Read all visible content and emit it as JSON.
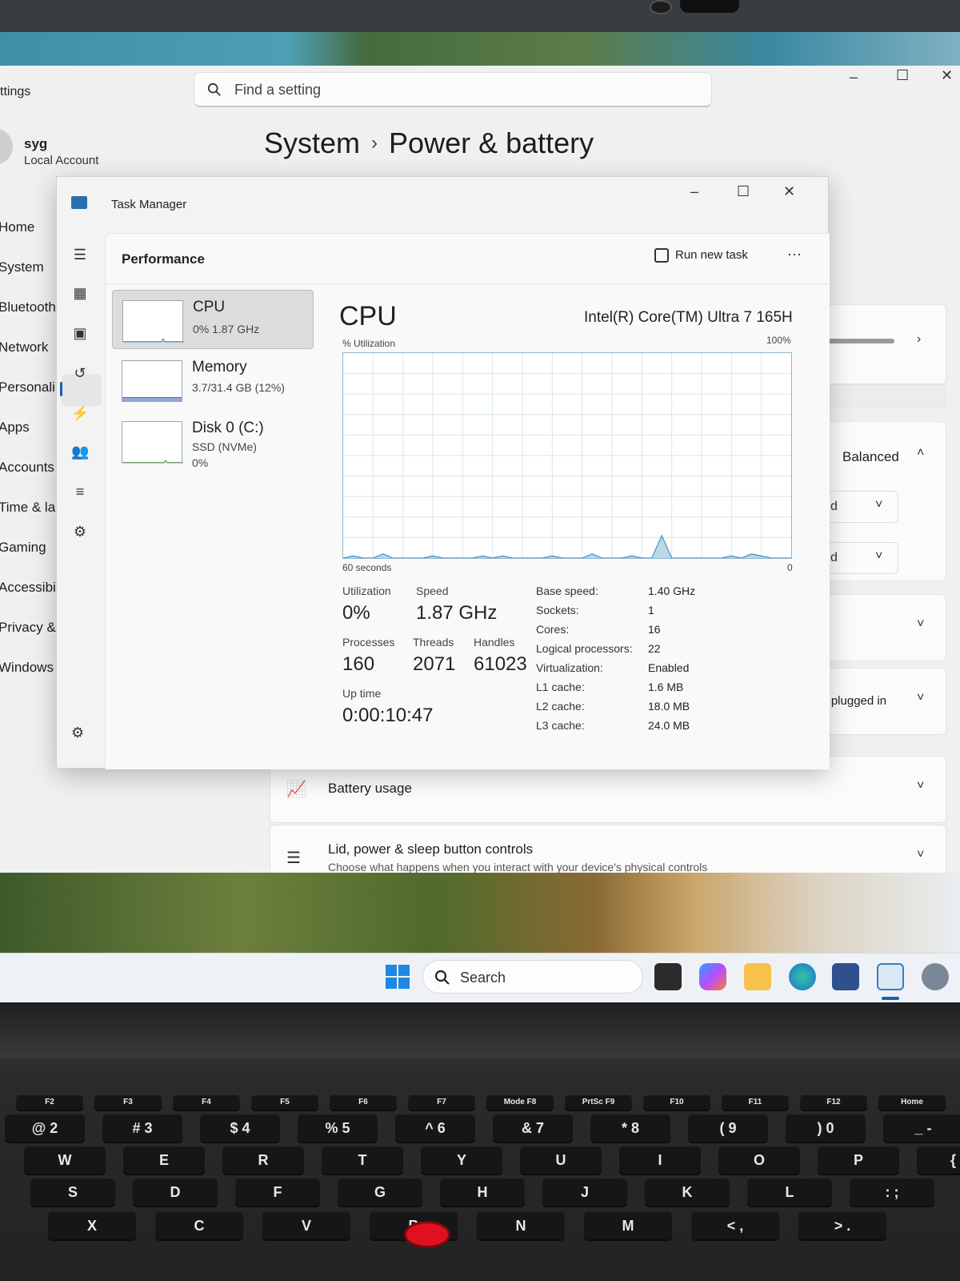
{
  "settings": {
    "title_fragment": "ttings",
    "search_placeholder": "Find a setting",
    "user": {
      "name": "syg",
      "type": "Local Account"
    },
    "breadcrumb": {
      "parent": "System",
      "current": "Power & battery"
    },
    "nav": [
      "Home",
      "System",
      "Bluetooth",
      "Network",
      "Personali",
      "Apps",
      "Accounts",
      "Time & la",
      "Gaming",
      "Accessibi",
      "Privacy &",
      "Windows"
    ],
    "power_mode_value": "Balanced",
    "select_fragment_1": "d",
    "select_fragment_2": "d",
    "plugged_fragment": "il plugged in",
    "battery_usage_label": "Battery usage",
    "lid_label": "Lid, power & sleep button controls",
    "lid_desc": "Choose what happens when you interact with your device's physical controls"
  },
  "task_manager": {
    "title": "Task Manager",
    "page": "Performance",
    "run_new_task": "Run new task",
    "more": "⋯",
    "resources": [
      {
        "name": "CPU",
        "sub1": "0% 1.87 GHz"
      },
      {
        "name": "Memory",
        "sub1": "3.7/31.4 GB (12%)"
      },
      {
        "name": "Disk 0 (C:)",
        "sub1": "SSD (NVMe)",
        "sub2": "0%"
      }
    ],
    "detail": {
      "heading": "CPU",
      "model": "Intel(R) Core(TM) Ultra 7 165H",
      "util_label": "% Utilization",
      "y_max": "100%",
      "x_left": "60 seconds",
      "x_right": "0",
      "utilization_label": "Utilization",
      "utilization": "0%",
      "speed_label": "Speed",
      "speed": "1.87 GHz",
      "processes_label": "Processes",
      "processes": "160",
      "threads_label": "Threads",
      "threads": "2071",
      "handles_label": "Handles",
      "handles": "61023",
      "uptime_label": "Up time",
      "uptime": "0:00:10:47",
      "specs": [
        {
          "label": "Base speed:",
          "value": "1.40 GHz"
        },
        {
          "label": "Sockets:",
          "value": "1"
        },
        {
          "label": "Cores:",
          "value": "16"
        },
        {
          "label": "Logical processors:",
          "value": "22"
        },
        {
          "label": "Virtualization:",
          "value": "Enabled"
        },
        {
          "label": "L1 cache:",
          "value": "1.6 MB"
        },
        {
          "label": "L2 cache:",
          "value": "18.0 MB"
        },
        {
          "label": "L3 cache:",
          "value": "24.0 MB"
        }
      ]
    },
    "cpu_history_percent": [
      0,
      1,
      0,
      0,
      2,
      0,
      0,
      0,
      0,
      1,
      0,
      0,
      0,
      0,
      1,
      0,
      1,
      0,
      0,
      0,
      0,
      1,
      0,
      0,
      0,
      2,
      0,
      0,
      0,
      1,
      0,
      0,
      11,
      0,
      0,
      0,
      0,
      0,
      0,
      1,
      0,
      2,
      1,
      0,
      0,
      0
    ],
    "accent": "#1a5fb4",
    "graph_fill": "#a9cfe4",
    "graph_line": "#4a90c0"
  },
  "taskbar": {
    "search_label": "Search",
    "apps": [
      "task-view",
      "copilot",
      "file-explorer",
      "edge",
      "store",
      "task-manager",
      "settings"
    ]
  },
  "keyboard": {
    "fn_row": [
      "F2",
      "F3",
      "F4",
      "F5",
      "F6",
      "F7",
      "Mode F8",
      "PrtSc F9",
      "F10",
      "F11",
      "F12",
      "Home"
    ],
    "number_row": [
      "@ 2",
      "# 3",
      "$ 4",
      "% 5",
      "^ 6",
      "& 7",
      "* 8",
      "( 9",
      ") 0",
      "_ -"
    ],
    "top_row": [
      "W",
      "E",
      "R",
      "T",
      "Y",
      "U",
      "I",
      "O",
      "P",
      "{ ["
    ],
    "home_row": [
      "S",
      "D",
      "F",
      "G",
      "H",
      "J",
      "K",
      "L",
      ": ;"
    ],
    "bottom_row": [
      "X",
      "C",
      "V",
      "B",
      "N",
      "M",
      "< ,",
      "> ."
    ]
  }
}
